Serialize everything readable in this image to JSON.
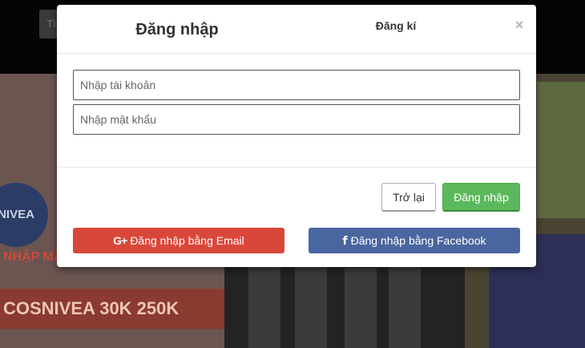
{
  "background": {
    "chip_text": "Tì",
    "promo_line": "NHẬP MÃ    GIẢM    ĐƠN TỪ",
    "promo_codes": "COSNIVEA  30K  250K",
    "brand": "NIVEA"
  },
  "modal": {
    "tabs": {
      "login": "Đăng nhập",
      "register": "Đăng kí"
    },
    "close_symbol": "×",
    "fields": {
      "username_placeholder": "Nhập tài khoản",
      "password_placeholder": "Nhập mật khẩu"
    },
    "buttons": {
      "back": "Trở lại",
      "login": "Đăng nhập"
    },
    "social": {
      "google_icon": "G+",
      "google_label": "Đăng nhập bằng Email",
      "facebook_icon": "f",
      "facebook_label": "Đăng nhập bằng Facebook"
    }
  },
  "colors": {
    "login_button": "#5cb85c",
    "google_button": "#d9473a",
    "facebook_button": "#4a66a0"
  }
}
